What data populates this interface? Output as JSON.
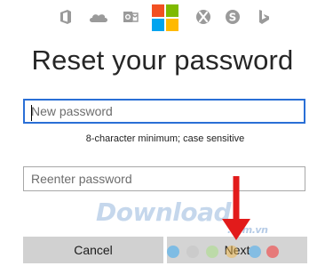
{
  "services": {
    "icons": [
      "office-icon",
      "onedrive-icon",
      "outlook-icon",
      "xbox-icon",
      "skype-icon",
      "bing-icon"
    ],
    "microsoft_logo_colors": [
      "#f25022",
      "#7fba00",
      "#00a4ef",
      "#ffb900"
    ]
  },
  "title": "Reset your password",
  "new_password": {
    "placeholder": "New password",
    "value": ""
  },
  "hint": "8-character minimum; case sensitive",
  "reenter_password": {
    "placeholder": "Reenter password",
    "value": ""
  },
  "buttons": {
    "cancel": "Cancel",
    "next": "Next"
  },
  "watermark": {
    "brand": "Download",
    "tld": ".com.vn",
    "dot_colors": [
      "#6fb7e6",
      "#c9c9c9",
      "#b7dba0",
      "#f0b545",
      "#6fb7e6",
      "#e96a6a"
    ]
  },
  "colors": {
    "focus_border": "#2a6fd6",
    "arrow": "#e21b1b"
  }
}
